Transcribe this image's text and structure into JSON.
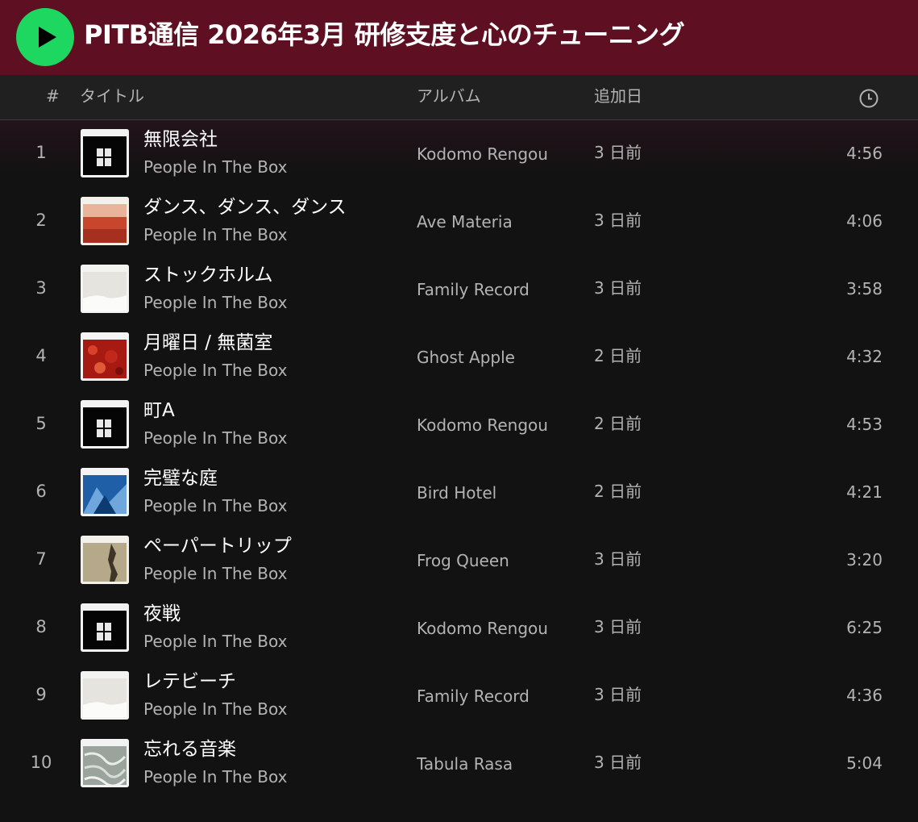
{
  "playlist": {
    "title": "PITB通信 2026年3月 研修支度と心のチューニング",
    "play_icon": "play-icon",
    "accent_color": "#1ed760",
    "header_color": "#5e0f21"
  },
  "columns": {
    "number": "#",
    "title": "タイトル",
    "album": "アルバム",
    "added": "追加日",
    "duration_icon": "clock-icon"
  },
  "tracks": [
    {
      "number": "1",
      "title": "無限会社",
      "artist": "People In The Box",
      "album": "Kodomo Rengou",
      "added": "3 日前",
      "duration": "4:56",
      "cover": "kodomo-rengou-cover"
    },
    {
      "number": "2",
      "title": "ダンス、ダンス、ダンス",
      "artist": "People In The Box",
      "album": "Ave Materia",
      "added": "3 日前",
      "duration": "4:06",
      "cover": "ave-materia-cover"
    },
    {
      "number": "3",
      "title": "ストックホルム",
      "artist": "People In The Box",
      "album": "Family Record",
      "added": "3 日前",
      "duration": "3:58",
      "cover": "family-record-cover"
    },
    {
      "number": "4",
      "title": "月曜日 / 無菌室",
      "artist": "People In The Box",
      "album": "Ghost Apple",
      "added": "2 日前",
      "duration": "4:32",
      "cover": "ghost-apple-cover"
    },
    {
      "number": "5",
      "title": "町A",
      "artist": "People In The Box",
      "album": "Kodomo Rengou",
      "added": "2 日前",
      "duration": "4:53",
      "cover": "kodomo-rengou-cover"
    },
    {
      "number": "6",
      "title": "完璧な庭",
      "artist": "People In The Box",
      "album": "Bird Hotel",
      "added": "2 日前",
      "duration": "4:21",
      "cover": "bird-hotel-cover"
    },
    {
      "number": "7",
      "title": "ペーパートリップ",
      "artist": "People In The Box",
      "album": "Frog Queen",
      "added": "3 日前",
      "duration": "3:20",
      "cover": "frog-queen-cover"
    },
    {
      "number": "8",
      "title": "夜戦",
      "artist": "People In The Box",
      "album": "Kodomo Rengou",
      "added": "3 日前",
      "duration": "6:25",
      "cover": "kodomo-rengou-cover"
    },
    {
      "number": "9",
      "title": "レテビーチ",
      "artist": "People In The Box",
      "album": "Family Record",
      "added": "3 日前",
      "duration": "4:36",
      "cover": "family-record-cover"
    },
    {
      "number": "10",
      "title": "忘れる音楽",
      "artist": "People In The Box",
      "album": "Tabula Rasa",
      "added": "3 日前",
      "duration": "5:04",
      "cover": "tabula-rasa-cover"
    }
  ]
}
